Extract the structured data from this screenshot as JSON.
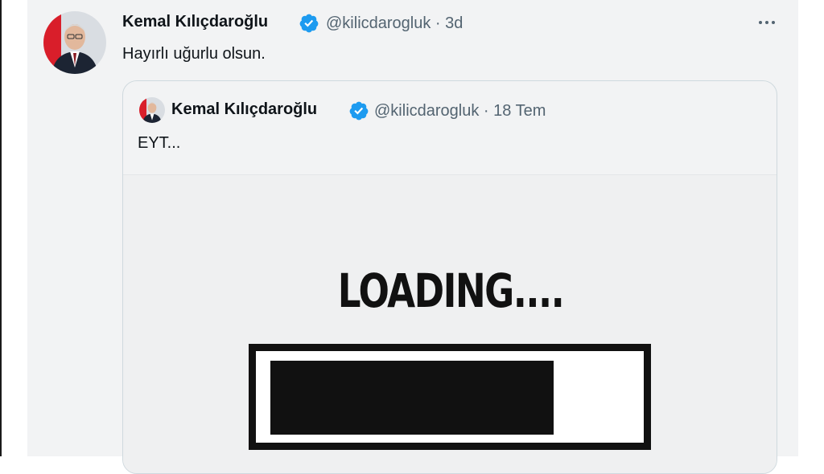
{
  "tweet": {
    "author_name": "Kemal Kılıçdaroğlu",
    "handle": "@kilicdarogluk",
    "time": "3d",
    "text": "Hayırlı uğurlu olsun."
  },
  "quoted_tweet": {
    "author_name": "Kemal Kılıçdaroğlu",
    "handle": "@kilicdarogluk",
    "time": "18 Tem",
    "text": "EYT...",
    "media": {
      "loading_text": "LOADING....",
      "progress_fraction": 0.79
    }
  },
  "icons": {
    "verified": "verified-badge-icon",
    "more": "more-options-icon"
  },
  "colors": {
    "verified_blue": "#1d9bf0",
    "name_text": "#0f1419",
    "secondary_text": "#536471",
    "background": "#f2f3f4"
  }
}
